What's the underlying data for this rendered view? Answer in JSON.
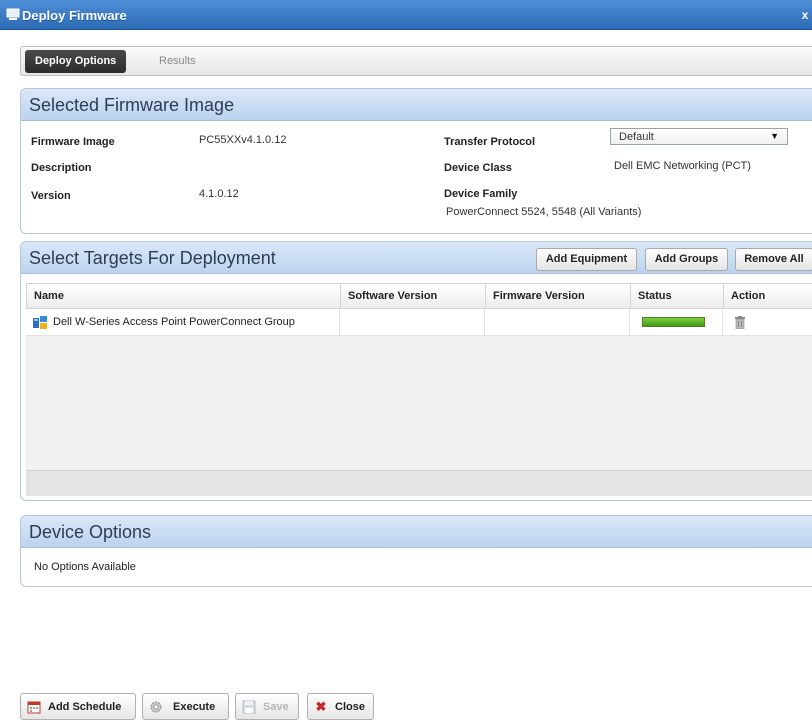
{
  "window": {
    "title": "Deploy Firmware",
    "close_glyph": "x"
  },
  "tabs": [
    {
      "label": "Deploy Options",
      "active": true
    },
    {
      "label": "Results",
      "active": false
    }
  ],
  "firmware_panel": {
    "title": "Selected Firmware Image",
    "firmware_image_label": "Firmware Image",
    "firmware_image_value": "PC55XXv4.1.0.12",
    "description_label": "Description",
    "description_value": "",
    "version_label": "Version",
    "version_value": "4.1.0.12",
    "transfer_protocol_label": "Transfer Protocol",
    "transfer_protocol_value": "Default",
    "device_class_label": "Device Class",
    "device_class_value": "Dell EMC Networking (PCT)",
    "device_family_label": "Device Family",
    "device_family_value": "PowerConnect 5524, 5548 (All Variants)"
  },
  "targets_panel": {
    "title": "Select Targets For Deployment",
    "buttons": {
      "add_equipment": "Add Equipment",
      "add_groups": "Add Groups",
      "remove_all": "Remove All"
    },
    "columns": [
      "Name",
      "Software Version",
      "Firmware Version",
      "Status",
      "Action"
    ],
    "rows": [
      {
        "name": "Dell W-Series Access Point PowerConnect Group",
        "software_version": "",
        "firmware_version": "",
        "status_progress": 1.0,
        "action_icon": "trash-icon"
      }
    ]
  },
  "device_options_panel": {
    "title": "Device Options",
    "message": "No Options Available"
  },
  "footer": {
    "add_schedule": "Add Schedule",
    "execute": "Execute",
    "save": "Save",
    "close": "Close"
  },
  "colors": {
    "titlebar": "#2c6bb5",
    "panel_header": "#bcd3ee",
    "status_green": "#3f9a16",
    "close_x_red": "#c62828"
  }
}
